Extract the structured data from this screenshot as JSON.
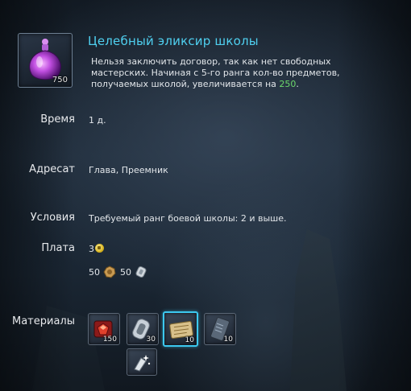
{
  "item": {
    "title": "Целебный эликсир школы",
    "count": "750",
    "icon": "elixir-potion-icon",
    "description_pre": "Нельзя заключить договор, так как нет свободных мастерских. Начиная с 5-го ранга кол-во предметов, получаемых школой, увеличивается на ",
    "description_highlight": "250",
    "description_post": "."
  },
  "rows": {
    "time": {
      "label": "Время",
      "value": "1 д."
    },
    "recipient": {
      "label": "Адресат",
      "value": "Глава, Преемник"
    },
    "conditions": {
      "label": "Условия",
      "value": "Требуемый ранг боевой школы: 2 и выше."
    },
    "payment": {
      "label": "Плата",
      "gold": "3",
      "currency_1": "50",
      "currency_2": "50"
    },
    "materials": {
      "label": "Материалы",
      "slots": [
        {
          "icon": "red-gem-box-icon",
          "count": "150"
        },
        {
          "icon": "silver-ring-icon",
          "count": "30"
        },
        {
          "icon": "scroll-icon",
          "count": "10",
          "selected": true
        },
        {
          "icon": "tablet-icon",
          "count": "10"
        }
      ],
      "extra": {
        "icon": "sparkle-shard-icon"
      }
    }
  },
  "colors": {
    "title": "#4fd0f0",
    "highlight": "#6cd86c",
    "selected_border": "#3cc8ef"
  }
}
